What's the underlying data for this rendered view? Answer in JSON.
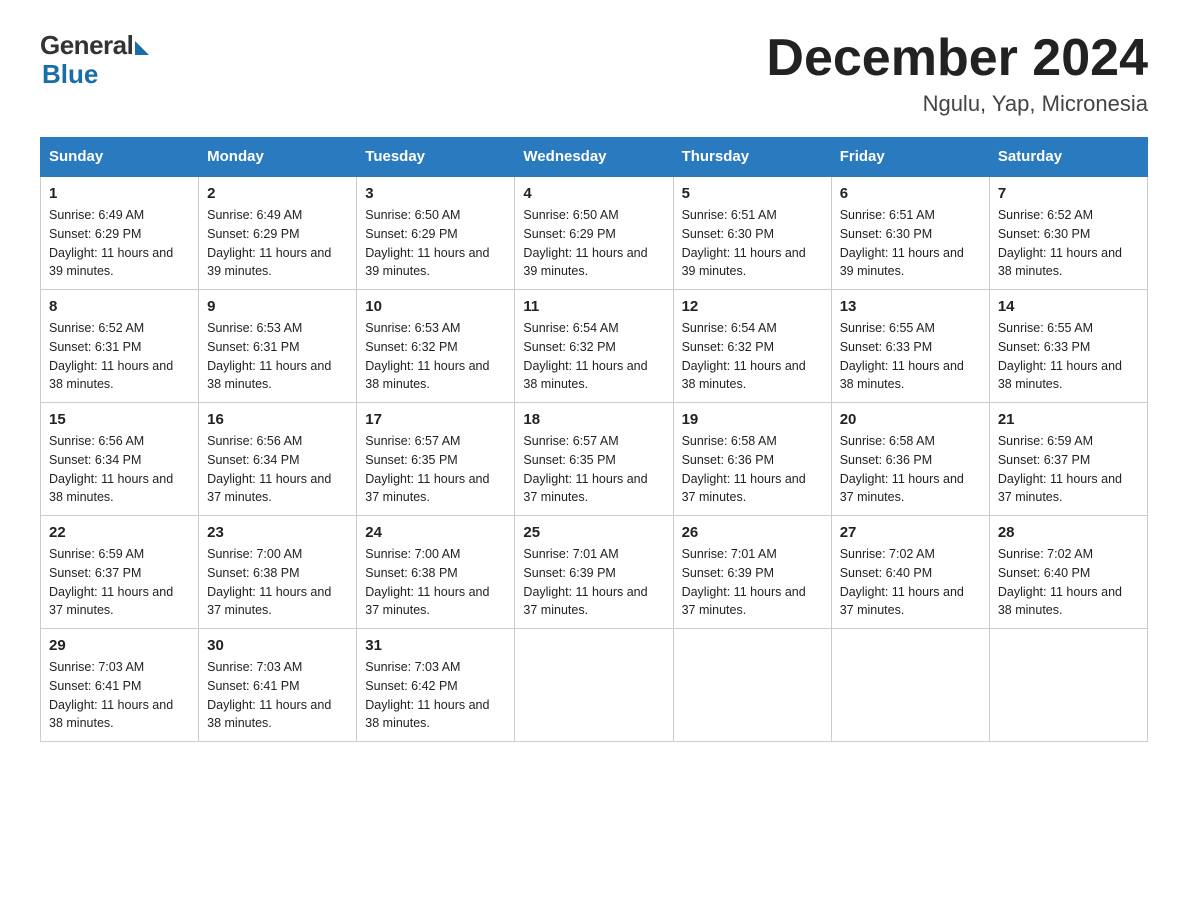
{
  "logo": {
    "general": "General",
    "blue": "Blue"
  },
  "header": {
    "month": "December 2024",
    "location": "Ngulu, Yap, Micronesia"
  },
  "days_of_week": [
    "Sunday",
    "Monday",
    "Tuesday",
    "Wednesday",
    "Thursday",
    "Friday",
    "Saturday"
  ],
  "weeks": [
    [
      {
        "day": "1",
        "sunrise": "6:49 AM",
        "sunset": "6:29 PM",
        "daylight": "11 hours and 39 minutes."
      },
      {
        "day": "2",
        "sunrise": "6:49 AM",
        "sunset": "6:29 PM",
        "daylight": "11 hours and 39 minutes."
      },
      {
        "day": "3",
        "sunrise": "6:50 AM",
        "sunset": "6:29 PM",
        "daylight": "11 hours and 39 minutes."
      },
      {
        "day": "4",
        "sunrise": "6:50 AM",
        "sunset": "6:29 PM",
        "daylight": "11 hours and 39 minutes."
      },
      {
        "day": "5",
        "sunrise": "6:51 AM",
        "sunset": "6:30 PM",
        "daylight": "11 hours and 39 minutes."
      },
      {
        "day": "6",
        "sunrise": "6:51 AM",
        "sunset": "6:30 PM",
        "daylight": "11 hours and 39 minutes."
      },
      {
        "day": "7",
        "sunrise": "6:52 AM",
        "sunset": "6:30 PM",
        "daylight": "11 hours and 38 minutes."
      }
    ],
    [
      {
        "day": "8",
        "sunrise": "6:52 AM",
        "sunset": "6:31 PM",
        "daylight": "11 hours and 38 minutes."
      },
      {
        "day": "9",
        "sunrise": "6:53 AM",
        "sunset": "6:31 PM",
        "daylight": "11 hours and 38 minutes."
      },
      {
        "day": "10",
        "sunrise": "6:53 AM",
        "sunset": "6:32 PM",
        "daylight": "11 hours and 38 minutes."
      },
      {
        "day": "11",
        "sunrise": "6:54 AM",
        "sunset": "6:32 PM",
        "daylight": "11 hours and 38 minutes."
      },
      {
        "day": "12",
        "sunrise": "6:54 AM",
        "sunset": "6:32 PM",
        "daylight": "11 hours and 38 minutes."
      },
      {
        "day": "13",
        "sunrise": "6:55 AM",
        "sunset": "6:33 PM",
        "daylight": "11 hours and 38 minutes."
      },
      {
        "day": "14",
        "sunrise": "6:55 AM",
        "sunset": "6:33 PM",
        "daylight": "11 hours and 38 minutes."
      }
    ],
    [
      {
        "day": "15",
        "sunrise": "6:56 AM",
        "sunset": "6:34 PM",
        "daylight": "11 hours and 38 minutes."
      },
      {
        "day": "16",
        "sunrise": "6:56 AM",
        "sunset": "6:34 PM",
        "daylight": "11 hours and 37 minutes."
      },
      {
        "day": "17",
        "sunrise": "6:57 AM",
        "sunset": "6:35 PM",
        "daylight": "11 hours and 37 minutes."
      },
      {
        "day": "18",
        "sunrise": "6:57 AM",
        "sunset": "6:35 PM",
        "daylight": "11 hours and 37 minutes."
      },
      {
        "day": "19",
        "sunrise": "6:58 AM",
        "sunset": "6:36 PM",
        "daylight": "11 hours and 37 minutes."
      },
      {
        "day": "20",
        "sunrise": "6:58 AM",
        "sunset": "6:36 PM",
        "daylight": "11 hours and 37 minutes."
      },
      {
        "day": "21",
        "sunrise": "6:59 AM",
        "sunset": "6:37 PM",
        "daylight": "11 hours and 37 minutes."
      }
    ],
    [
      {
        "day": "22",
        "sunrise": "6:59 AM",
        "sunset": "6:37 PM",
        "daylight": "11 hours and 37 minutes."
      },
      {
        "day": "23",
        "sunrise": "7:00 AM",
        "sunset": "6:38 PM",
        "daylight": "11 hours and 37 minutes."
      },
      {
        "day": "24",
        "sunrise": "7:00 AM",
        "sunset": "6:38 PM",
        "daylight": "11 hours and 37 minutes."
      },
      {
        "day": "25",
        "sunrise": "7:01 AM",
        "sunset": "6:39 PM",
        "daylight": "11 hours and 37 minutes."
      },
      {
        "day": "26",
        "sunrise": "7:01 AM",
        "sunset": "6:39 PM",
        "daylight": "11 hours and 37 minutes."
      },
      {
        "day": "27",
        "sunrise": "7:02 AM",
        "sunset": "6:40 PM",
        "daylight": "11 hours and 37 minutes."
      },
      {
        "day": "28",
        "sunrise": "7:02 AM",
        "sunset": "6:40 PM",
        "daylight": "11 hours and 38 minutes."
      }
    ],
    [
      {
        "day": "29",
        "sunrise": "7:03 AM",
        "sunset": "6:41 PM",
        "daylight": "11 hours and 38 minutes."
      },
      {
        "day": "30",
        "sunrise": "7:03 AM",
        "sunset": "6:41 PM",
        "daylight": "11 hours and 38 minutes."
      },
      {
        "day": "31",
        "sunrise": "7:03 AM",
        "sunset": "6:42 PM",
        "daylight": "11 hours and 38 minutes."
      },
      null,
      null,
      null,
      null
    ]
  ]
}
